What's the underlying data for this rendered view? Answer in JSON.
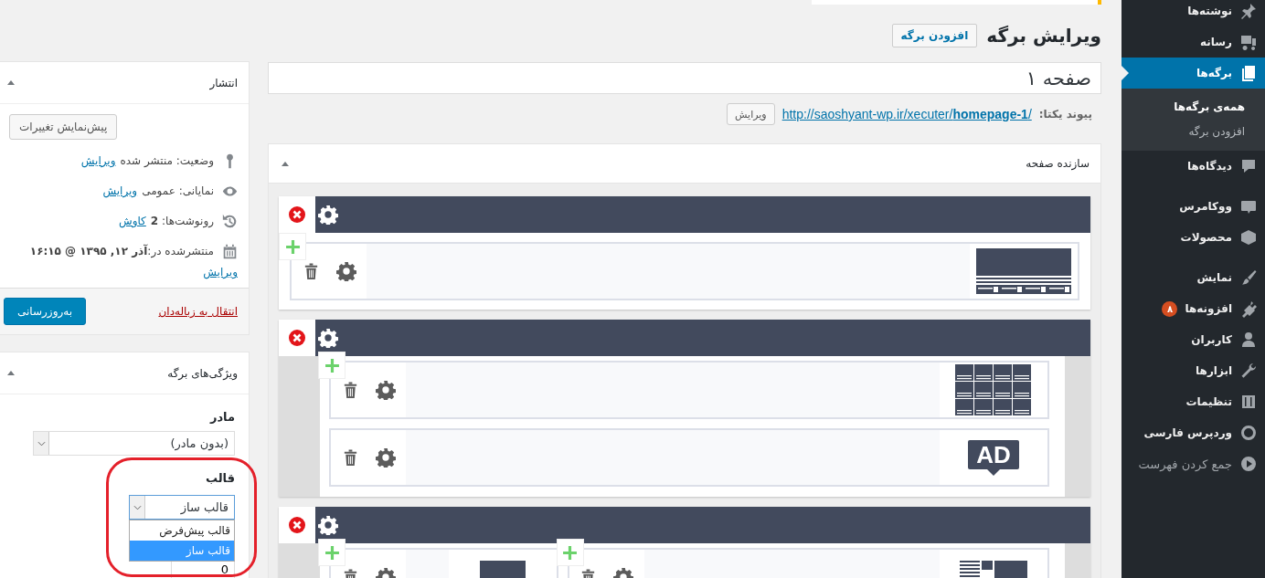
{
  "admin_menu": {
    "groups": [
      [
        {
          "label": "نوشته‌ها",
          "selected": false
        },
        {
          "label": "رسانه",
          "selected": false
        },
        {
          "label": "برگه‌ها",
          "selected": true,
          "children": [
            {
              "label": "همه‌ی برگه‌ها",
              "selected": true
            },
            {
              "label": "افزودن برگه",
              "selected": false
            }
          ]
        },
        {
          "label": "دیدگاه‌ها",
          "selected": false
        }
      ],
      [
        {
          "label": "ووکامرس",
          "selected": false
        },
        {
          "label": "محصولات",
          "selected": false
        }
      ],
      [
        {
          "label": "نمایش",
          "selected": false
        },
        {
          "label": "افزونه‌ها",
          "selected": false,
          "badge": "۸"
        },
        {
          "label": "کاربران",
          "selected": false
        },
        {
          "label": "ابزارها",
          "selected": false
        },
        {
          "label": "تنظیمات",
          "selected": false
        },
        {
          "label": "وردپرس فارسی",
          "selected": false
        }
      ]
    ],
    "collapse": "جمع کردن فهرست"
  },
  "header": {
    "title": "ویرایش برگه",
    "add_button": "افزودن برگه"
  },
  "title_field": {
    "value": "صفحه ۱"
  },
  "permalink": {
    "label": "پیوند یکتا:",
    "url": "http://saoshyant-wp.ir/xecuter/**homepage-1**/",
    "edit_button": "ویرایش"
  },
  "publish": {
    "title": "انتشار",
    "expanded": true,
    "preview_button": "پیش‌نمایش تغییرات",
    "rows": [
      {
        "text": "وضعیت: منتشر شده",
        "link": "ویرایش"
      },
      {
        "text": "نمایانی: عمومی",
        "link": "ویرایش"
      },
      {
        "text": "رونوشت‌ها: **2**",
        "link": "کاوش"
      },
      {
        "text": "منتشرشده در:**آذر ۱۲, ۱۳۹۵ @ ۱۶:۱۵**",
        "link": "ویرایش"
      }
    ],
    "trash_link": "انتقال به زباله‌دان",
    "update_button": "به‌روزرسانی"
  },
  "attributes": {
    "title": "ویژگی‌های برگه",
    "expanded": true,
    "parent": {
      "label": "مادر",
      "value": "(بدون مادر)"
    },
    "template": {
      "label": "قالب",
      "value": "قالب ساز",
      "expanded": true,
      "options": [
        {
          "label": "قالب پیش‌فرض",
          "selected": false
        },
        {
          "label": "قالب ساز",
          "selected": true
        }
      ]
    },
    "order": {
      "value": "0"
    }
  },
  "builder": {
    "title": "سازنده صفحه",
    "expanded": true,
    "sections": [
      {
        "boxed": false,
        "columns": [
          {
            "modules": [
              {
                "kind": "slider"
              }
            ]
          }
        ]
      },
      {
        "boxed": true,
        "columns": [
          {
            "modules": [
              {
                "kind": "grid"
              },
              {
                "kind": "ad",
                "label": "AD"
              }
            ]
          }
        ]
      },
      {
        "boxed": true,
        "columns": [
          {
            "modules": [
              {
                "kind": "text-image"
              }
            ]
          },
          {
            "modules": [
              {
                "kind": "image"
              }
            ]
          }
        ]
      }
    ]
  }
}
